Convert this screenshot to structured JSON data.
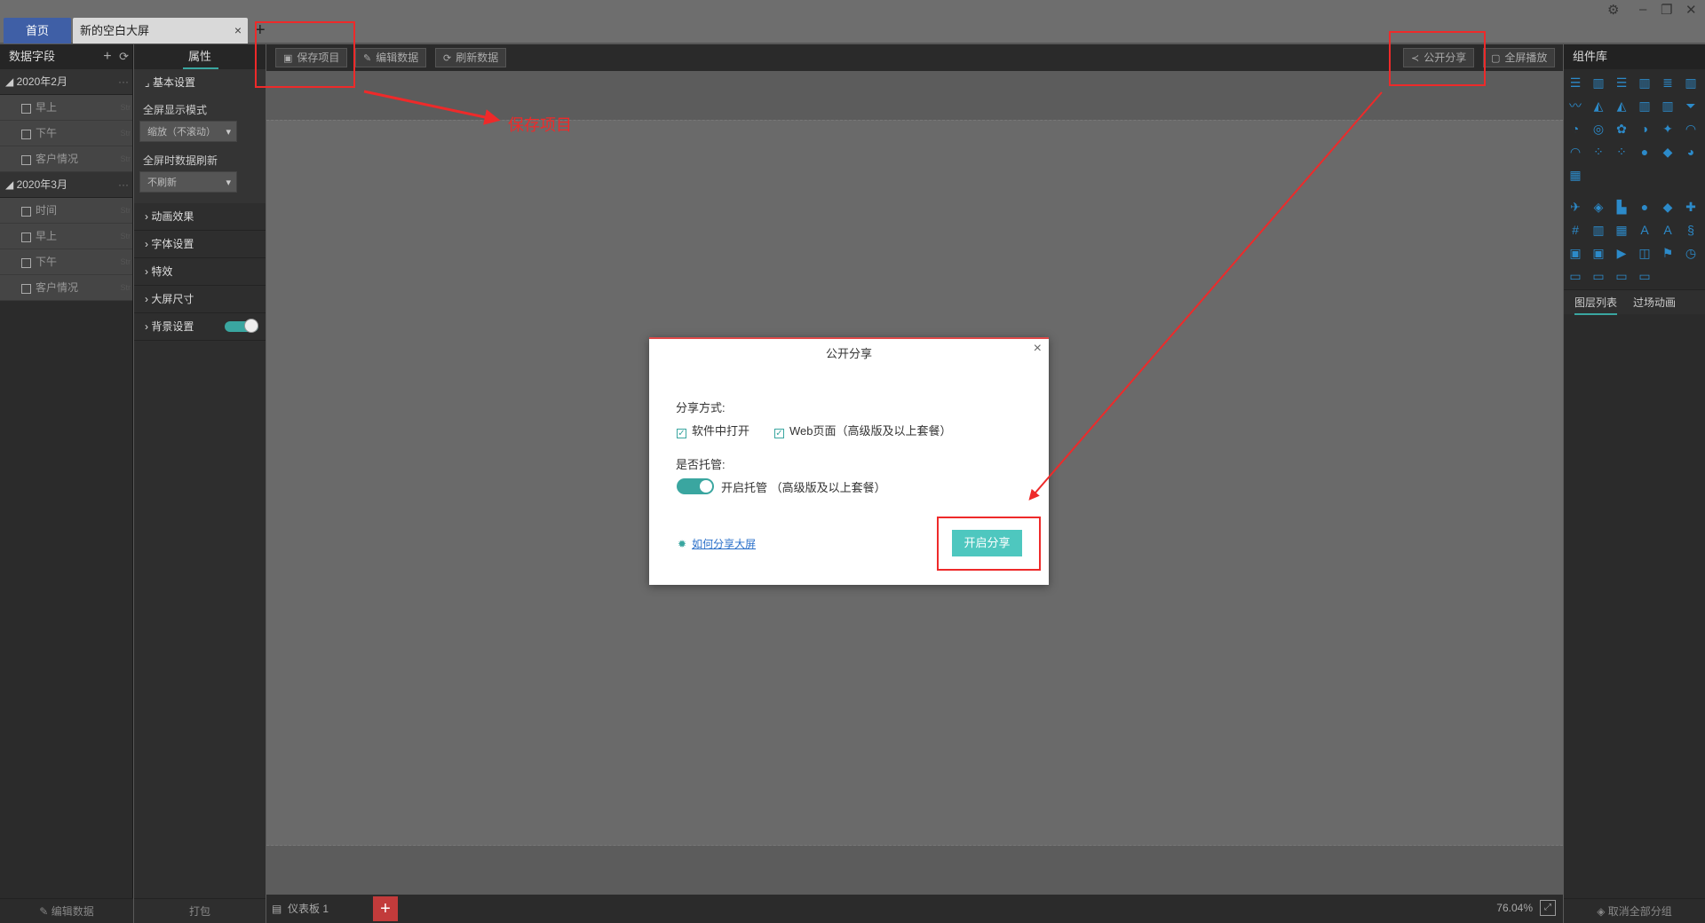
{
  "tabs": {
    "home": "首页",
    "active": "新的空白大屏",
    "close": "×",
    "add": "+"
  },
  "window_controls": {
    "settings": "⚙",
    "minimize": "–",
    "restore": "❐",
    "close": "✕"
  },
  "field_panel": {
    "title": "数据字段",
    "groups": [
      {
        "label": "2020年2月",
        "items": [
          "早上",
          "下午",
          "客户情况"
        ]
      },
      {
        "label": "2020年3月",
        "items": [
          "时间",
          "早上",
          "下午",
          "客户情况"
        ]
      }
    ],
    "footer": "编辑数据"
  },
  "prop_panel": {
    "title": "属性",
    "basic_section": "基本设置",
    "fullscreen_mode_label": "全屏显示模式",
    "fullscreen_mode_value": "缩放（不滚动）",
    "refresh_label": "全屏时数据刷新",
    "refresh_value": "不刷新",
    "sections": [
      "动画效果",
      "字体设置",
      "特效",
      "大屏尺寸",
      "背景设置"
    ],
    "footer": "打包"
  },
  "toolbar": {
    "save": "保存项目",
    "edit_data": "编辑数据",
    "refresh_data": "刷新数据",
    "share": "公开分享",
    "fullscreen": "全屏播放"
  },
  "bottombar": {
    "sheet": "仪表板 1",
    "add": "+",
    "zoom": "76.04%"
  },
  "library": {
    "title": "组件库",
    "tab_layers": "图层列表",
    "tab_transitions": "过场动画",
    "footer": "取消全部分组"
  },
  "modal": {
    "title": "公开分享",
    "share_method_label": "分享方式:",
    "opt_software": "软件中打开",
    "opt_web": "Web页面（高级版及以上套餐）",
    "hosting_label": "是否托管:",
    "hosting_switch": "开启托管  （高级版及以上套餐）",
    "help_link": "如何分享大屏",
    "start_button": "开启分享"
  },
  "annotation": {
    "save_label": "保存项目"
  },
  "colors": {
    "accent": "#3aa6a0",
    "annotation": "#ee2a2a",
    "tab_home": "#3f5fa6",
    "button": "#4ec7bf"
  }
}
